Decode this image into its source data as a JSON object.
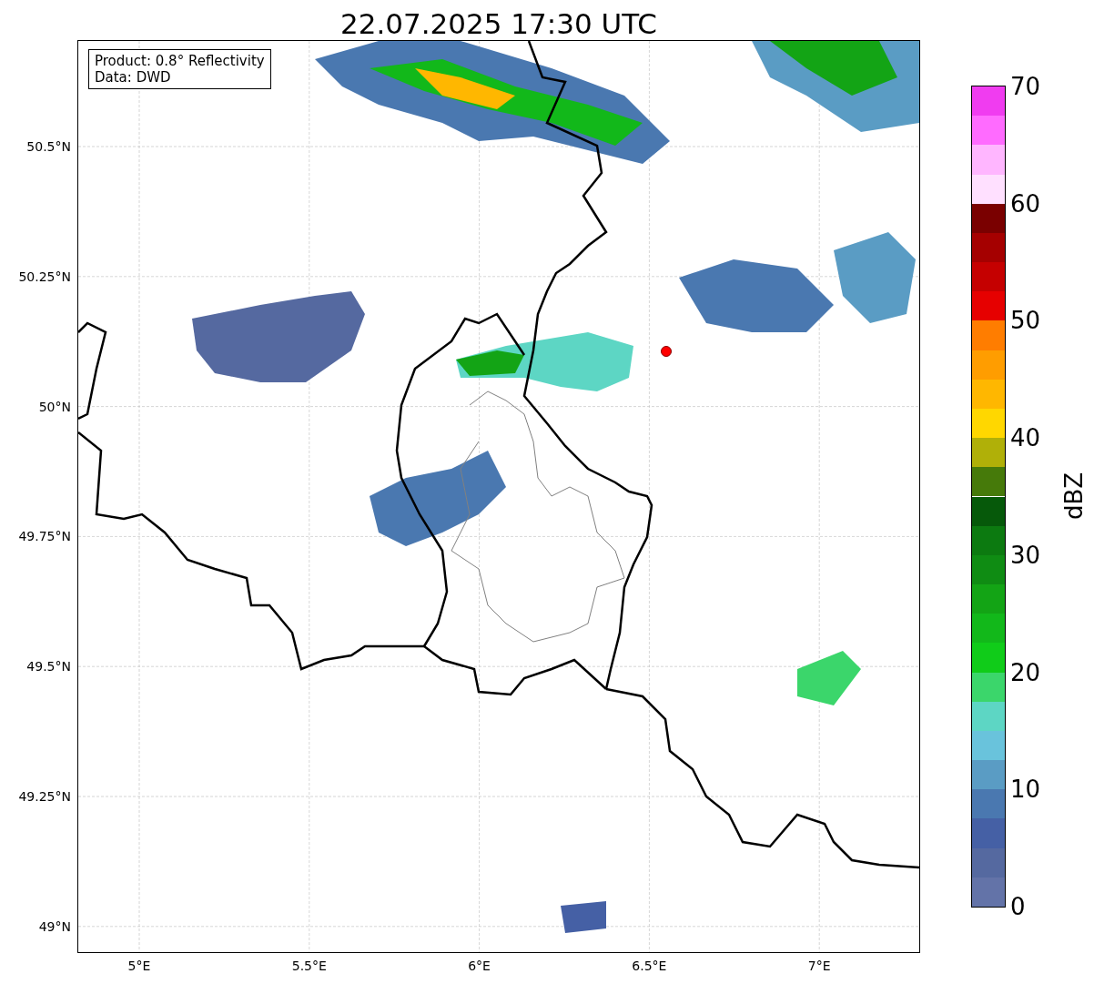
{
  "title": "22.07.2025 17:30 UTC",
  "map": {
    "info_box": [
      "Product: 0.8° Reflectivity",
      "Data: DWD"
    ],
    "x_ticks": [
      "5°E",
      "5.5°E",
      "6°E",
      "6.5°E",
      "7°E"
    ],
    "y_ticks": [
      "50.5°N",
      "50.25°N",
      "50°N",
      "49.75°N",
      "49.5°N",
      "49.25°N",
      "49°N"
    ]
  },
  "colorbar": {
    "label": "dBZ",
    "ticks": [
      "70",
      "60",
      "50",
      "40",
      "30",
      "20",
      "10",
      "0"
    ],
    "bins": [
      {
        "color": "#6373a8"
      },
      {
        "color": "#5569a0"
      },
      {
        "color": "#4560a5"
      },
      {
        "color": "#4a78b0"
      },
      {
        "color": "#5a9cc4"
      },
      {
        "color": "#69c3dc"
      },
      {
        "color": "#5dd6c4"
      },
      {
        "color": "#3bd66b"
      },
      {
        "color": "#10cc19"
      },
      {
        "color": "#12b81a"
      },
      {
        "color": "#13a415"
      },
      {
        "color": "#0f8c13"
      },
      {
        "color": "#0c7a10"
      },
      {
        "color": "#06590a"
      },
      {
        "color": "#467a0a"
      },
      {
        "color": "#b0b008"
      },
      {
        "color": "#ffd700"
      },
      {
        "color": "#ffb700"
      },
      {
        "color": "#ff9d00"
      },
      {
        "color": "#ff7d00"
      },
      {
        "color": "#e60000"
      },
      {
        "color": "#c50000"
      },
      {
        "color": "#a50000"
      },
      {
        "color": "#7a0000"
      },
      {
        "color": "#ffe0ff"
      },
      {
        "color": "#ffb6ff"
      },
      {
        "color": "#ff6bff"
      },
      {
        "color": "#f03cf0"
      }
    ]
  }
}
